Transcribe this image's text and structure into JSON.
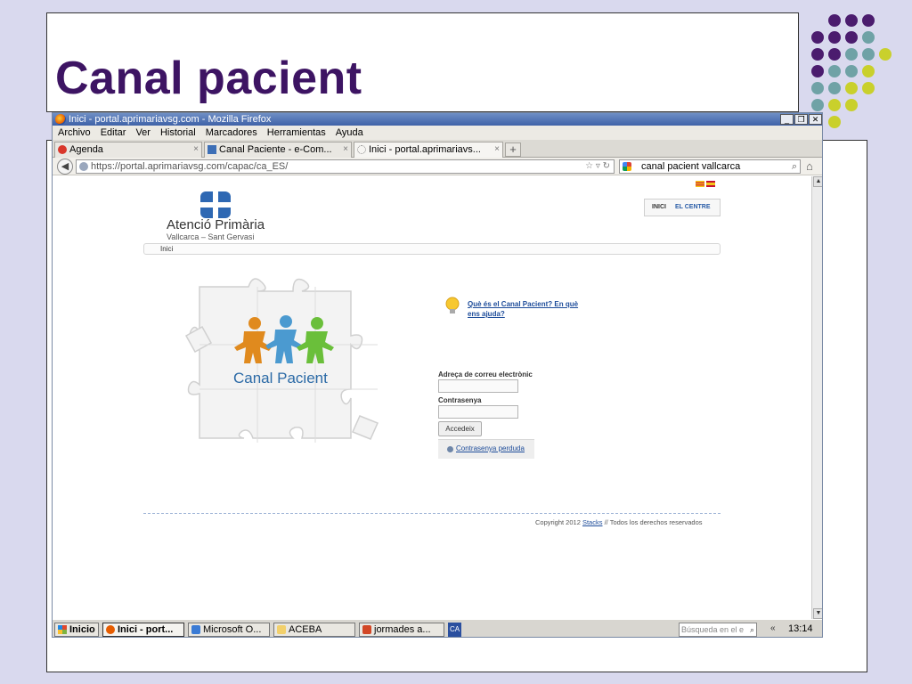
{
  "slide": {
    "title": "Canal pacient",
    "colors": {
      "title": "#3d1463",
      "purple": "#4b1c6e",
      "teal": "#6fa2a6",
      "lime": "#c9d02c"
    }
  },
  "browser": {
    "window_title": "Inici - portal.aprimariavsg.com - Mozilla Firefox",
    "menu": [
      "Archivo",
      "Editar",
      "Ver",
      "Historial",
      "Marcadores",
      "Herramientas",
      "Ayuda"
    ],
    "tabs": [
      {
        "label": "Agenda",
        "icon": "calendar-icon"
      },
      {
        "label": "Canal Paciente - e-Com...",
        "icon": "page-icon"
      },
      {
        "label": "Inici - portal.aprimariavs...",
        "icon": "loading-icon"
      }
    ],
    "url": "https://portal.aprimariavsg.com/capac/ca_ES/",
    "search_value": "canal pacient vallcarca"
  },
  "page": {
    "logo_title": "Atenció Primària",
    "logo_subtitle": "Vallcarca – Sant Gervasi",
    "nav": {
      "inici": "INICI",
      "centre": "EL CENTRE"
    },
    "breadcrumb": "Inici",
    "puzzle_label": "Canal Pacient",
    "help_link": "Què és el Canal Pacient? En què ens ajuda?",
    "email_label": "Adreça de correu electrònic",
    "password_label": "Contrasenya",
    "login_button": "Accedeix",
    "lost_password": "Contrasenya perduda",
    "copyright_prefix": "Copyright 2012",
    "copyright_link": "Stacks",
    "copyright_suffix": "// Todos los derechos reservados"
  },
  "taskbar": {
    "start": "Inicio",
    "items": [
      "Inici - port...",
      "Microsoft O...",
      "ACEBA",
      "jormades a..."
    ],
    "ca_badge": "CA",
    "search_placeholder": "Búsqueda en el e",
    "chevron": "«",
    "clock": "13:14"
  }
}
